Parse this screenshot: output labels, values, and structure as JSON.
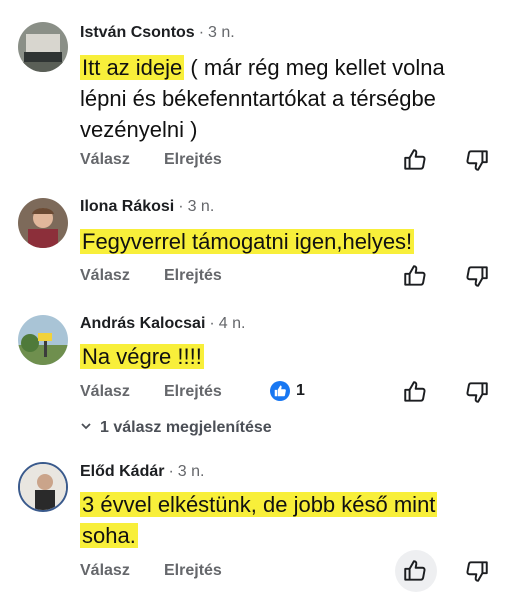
{
  "comments": [
    {
      "author": "István Csontos",
      "time": "3 n.",
      "lines": [
        "Itt az ideje",
        " ( már rég meg kellet volna",
        "lépni és békefenntartókat a térségbe",
        "vezényelni )"
      ],
      "reply_label": "Válasz",
      "hide_label": "Elrejtés"
    },
    {
      "author": "Ilona Rákosi",
      "time": "3 n.",
      "lines": [
        "Fegyverrel támogatni igen,helyes!"
      ],
      "reply_label": "Válasz",
      "hide_label": "Elrejtés"
    },
    {
      "author": "András Kalocsai",
      "time": "4 n.",
      "lines": [
        "Na végre !!!!"
      ],
      "reply_label": "Válasz",
      "hide_label": "Elrejtés",
      "reaction_count": "1",
      "replies_link": "1 válasz megjelenítése"
    },
    {
      "author": "Előd Kádár",
      "time": "3 n.",
      "lines": [
        "3 évvel elkéstünk, de jobb késő mint",
        "soha."
      ],
      "reply_label": "Válasz",
      "hide_label": "Elrejtés"
    }
  ],
  "icons": {
    "like": "thumbs-up-icon",
    "dislike": "thumbs-down-icon",
    "reaction": "like-reaction-icon",
    "chevron": "chevron-down-icon"
  },
  "colors": {
    "highlight": "#f8ef3a",
    "reaction_blue": "#1877f2",
    "secondary_text": "#65676b"
  }
}
